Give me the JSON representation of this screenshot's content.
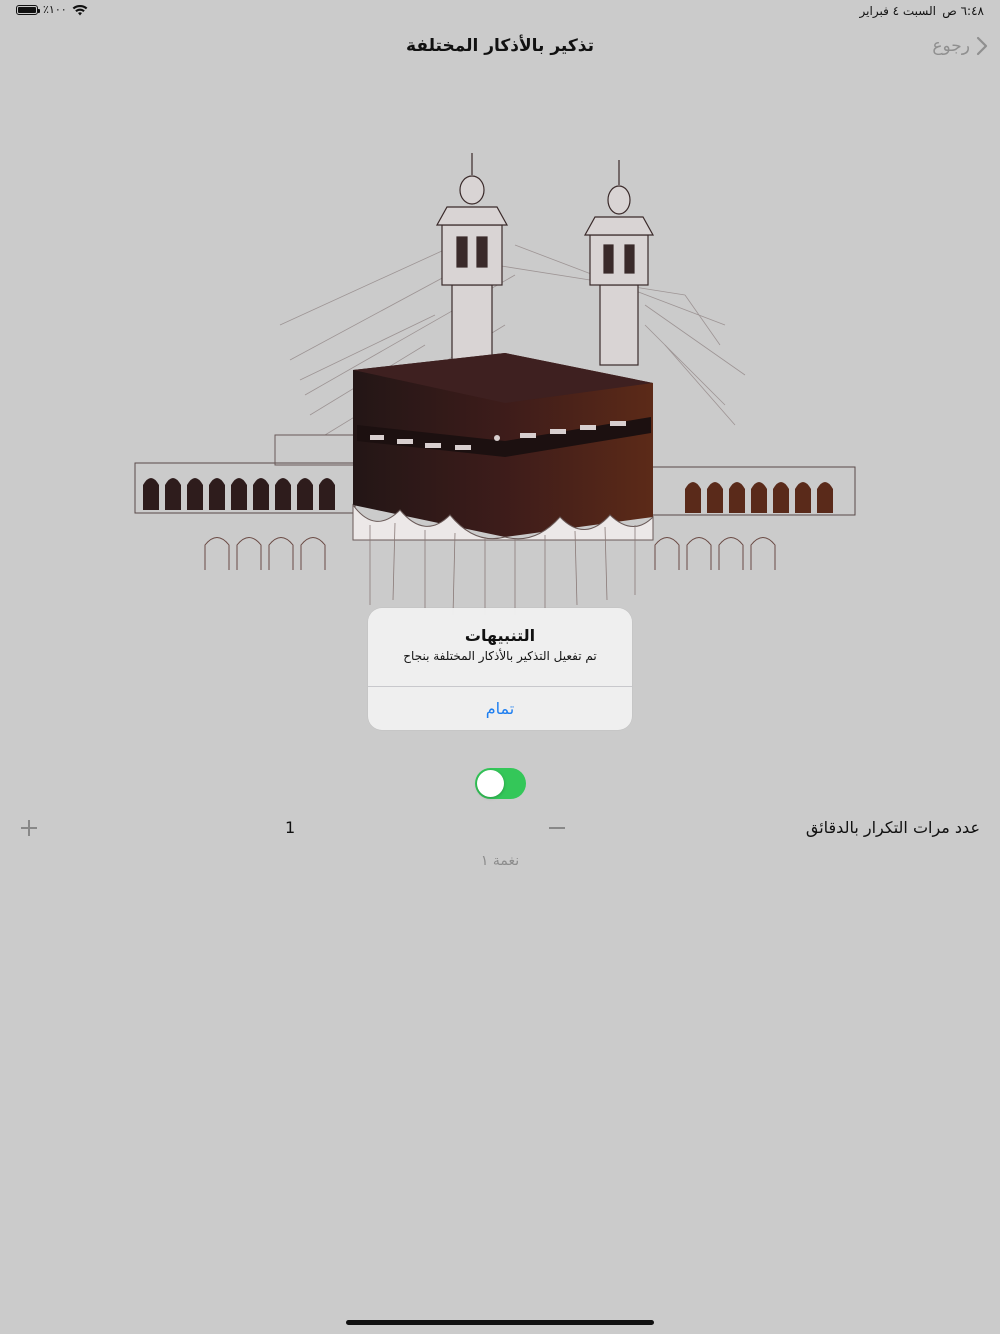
{
  "status_bar": {
    "time": "٦:٤٨ ص",
    "date": "السبت ٤ فبراير",
    "battery": "٪١٠٠",
    "wifi_icon": "wifi-icon",
    "battery_icon": "battery-icon"
  },
  "nav": {
    "title": "تذكير بالأذكار المختلفة",
    "back_label": "رجوع",
    "back_icon": "chevron-right-icon"
  },
  "illustration": {
    "icon": "kaaba-illustration"
  },
  "alert": {
    "title": "التنبيهات",
    "message": "تم تفعيل التذكير بالأذكار المختلفة بنجاح",
    "ok_label": "تمام"
  },
  "settings": {
    "toggle_on": true,
    "repeat_label": "عدد مرات التكرار بالدقائق",
    "repeat_value": "1",
    "tone_label": "نغمة ١"
  },
  "colors": {
    "background": "#cbcbcb",
    "toggle_on": "#34c759",
    "link_blue": "#1d7ef0",
    "kaaba_dark": "#3a1a1a",
    "kaaba_accent": "#6b2a1a"
  }
}
